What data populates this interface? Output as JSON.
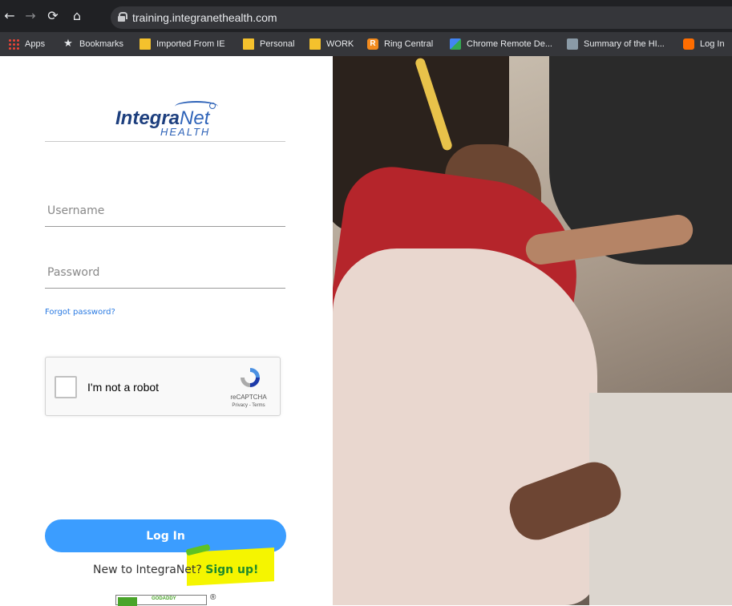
{
  "browser": {
    "url": "training.integranethealth.com",
    "bookmarks": [
      {
        "label": "Apps",
        "icon": "apps-icon"
      },
      {
        "label": "Bookmarks",
        "icon": "star-icon"
      },
      {
        "label": "Imported From IE",
        "icon": "folder-icon"
      },
      {
        "label": "Personal",
        "icon": "folder-icon"
      },
      {
        "label": "WORK",
        "icon": "folder-icon"
      },
      {
        "label": "Ring Central",
        "icon": "ringcentral-icon"
      },
      {
        "label": "Chrome Remote De...",
        "icon": "chrome-remote-desktop-icon"
      },
      {
        "label": "Summary of the HI...",
        "icon": "document-icon"
      },
      {
        "label": "Log In",
        "icon": "login-icon"
      }
    ]
  },
  "login": {
    "logo_main": "Integra",
    "logo_net": "Net",
    "logo_sub": "HEALTH",
    "username_placeholder": "Username",
    "password_placeholder": "Password",
    "forgot_password": "Forgot password?",
    "captcha_label": "I'm not a robot",
    "captcha_brand": "reCAPTCHA",
    "captcha_links": "Privacy - Terms",
    "login_button": "Log In",
    "signup_prompt": "New to IntegraNet?",
    "signup_link": "Sign up!",
    "badge_text": "GODADDY",
    "badge_mark": "®"
  },
  "colors": {
    "primary_button": "#3b9dff",
    "link": "#2a7ae2",
    "signup_link": "#1e8a2c",
    "highlight": "#f5f500"
  }
}
